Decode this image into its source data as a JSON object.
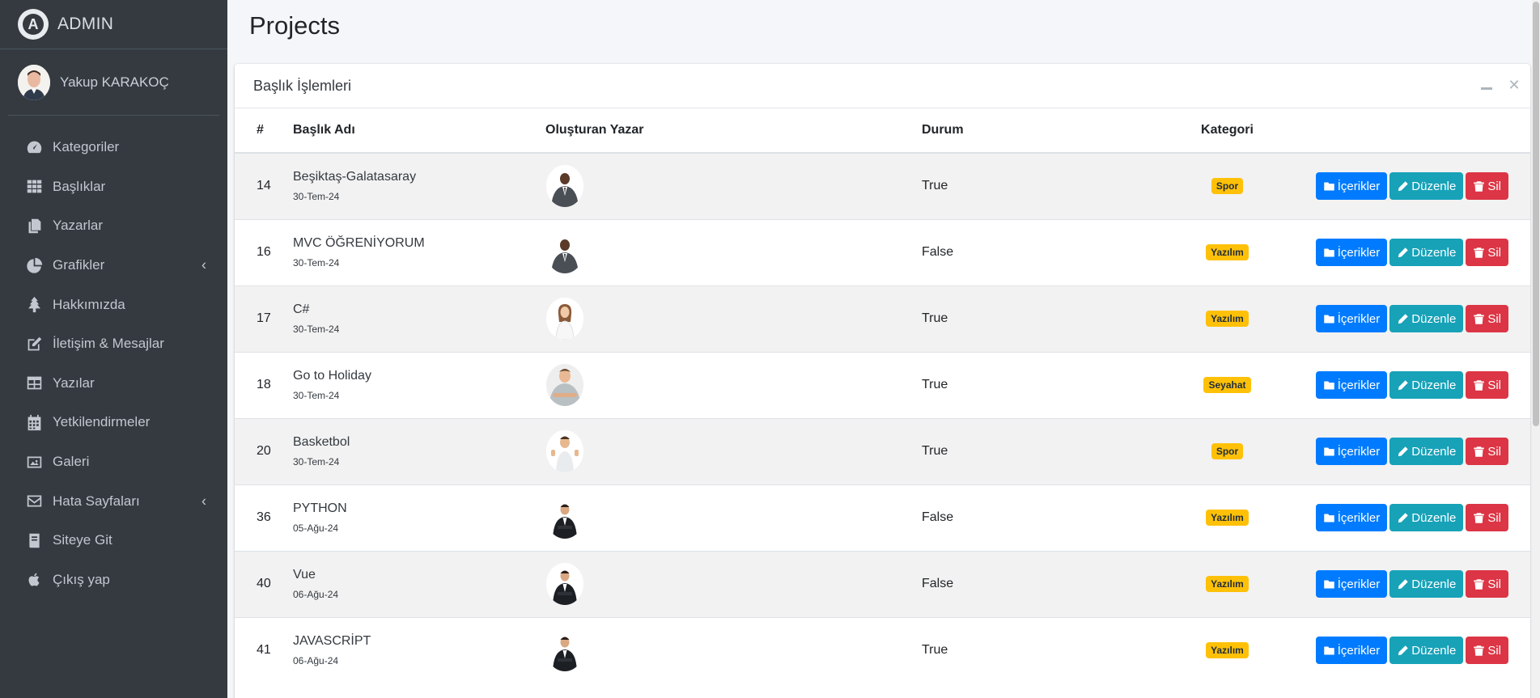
{
  "brand": {
    "logo_letter": "A",
    "name": "ADMIN"
  },
  "user": {
    "name": "Yakup KARAKOÇ"
  },
  "nav": [
    {
      "label": "Kategoriler",
      "icon": "dashboard-icon",
      "arrow": false
    },
    {
      "label": "Başlıklar",
      "icon": "grid-icon",
      "arrow": false
    },
    {
      "label": "Yazarlar",
      "icon": "copy-icon",
      "arrow": false
    },
    {
      "label": "Grafikler",
      "icon": "pie-chart-icon",
      "arrow": true
    },
    {
      "label": "Hakkımızda",
      "icon": "tree-icon",
      "arrow": false
    },
    {
      "label": "İletişim & Mesajlar",
      "icon": "edit-icon",
      "arrow": false
    },
    {
      "label": "Yazılar",
      "icon": "table-icon",
      "arrow": false
    },
    {
      "label": "Yetkilendirmeler",
      "icon": "calendar-icon",
      "arrow": false
    },
    {
      "label": "Galeri",
      "icon": "image-icon",
      "arrow": false
    },
    {
      "label": "Hata Sayfaları",
      "icon": "envelope-icon",
      "arrow": true
    },
    {
      "label": "Siteye Git",
      "icon": "book-icon",
      "arrow": false
    },
    {
      "label": "Çıkış yap",
      "icon": "apple-icon",
      "arrow": false
    }
  ],
  "page": {
    "title": "Projects"
  },
  "card": {
    "title": "Başlık İşlemleri"
  },
  "table": {
    "headers": {
      "id": "#",
      "title": "Başlık Adı",
      "author": "Oluşturan Yazar",
      "status": "Durum",
      "category": "Kategori"
    },
    "rows": [
      {
        "id": "14",
        "title": "Beşiktaş-Galatasaray",
        "date": "30-Tem-24",
        "author_style": "dark-suit",
        "status": "True",
        "category": "Spor"
      },
      {
        "id": "16",
        "title": "MVC ÖĞRENİYORUM",
        "date": "30-Tem-24",
        "author_style": "dark-suit",
        "status": "False",
        "category": "Yazılım"
      },
      {
        "id": "17",
        "title": "C#",
        "date": "30-Tem-24",
        "author_style": "woman-white",
        "status": "True",
        "category": "Yazılım"
      },
      {
        "id": "18",
        "title": "Go to Holiday",
        "date": "30-Tem-24",
        "author_style": "man-tshirt",
        "status": "True",
        "category": "Seyahat"
      },
      {
        "id": "20",
        "title": "Basketbol",
        "date": "30-Tem-24",
        "author_style": "man-thumbs",
        "status": "True",
        "category": "Spor"
      },
      {
        "id": "36",
        "title": "PYTHON",
        "date": "05-Ağu-24",
        "author_style": "black-suit",
        "status": "False",
        "category": "Yazılım"
      },
      {
        "id": "40",
        "title": "Vue",
        "date": "06-Ağu-24",
        "author_style": "black-suit",
        "status": "False",
        "category": "Yazılım"
      },
      {
        "id": "41",
        "title": "JAVASCRİPT",
        "date": "06-Ağu-24",
        "author_style": "black-suit",
        "status": "True",
        "category": "Yazılım"
      }
    ]
  },
  "buttons": {
    "contents": "İçerikler",
    "edit": "Düzenle",
    "delete": "Sil"
  },
  "colors": {
    "sidebar": "#343a40",
    "primary": "#007bff",
    "info": "#17a2b8",
    "danger": "#dc3545",
    "badge": "#ffc107"
  }
}
